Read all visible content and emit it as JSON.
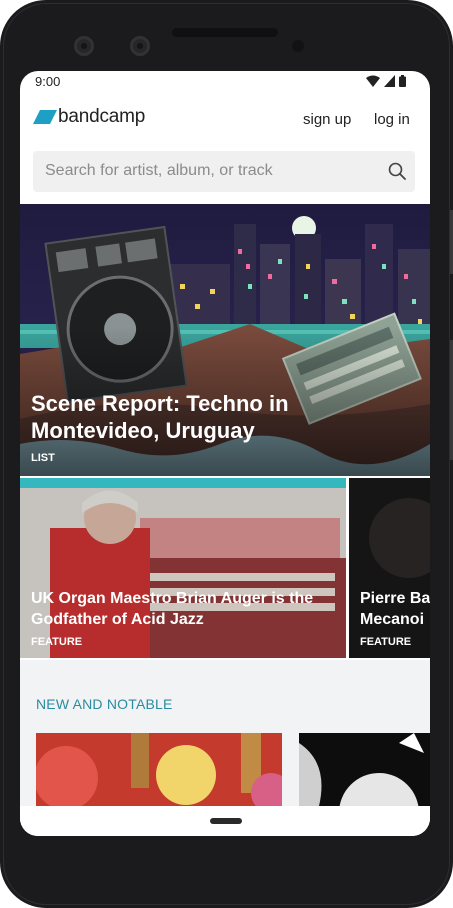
{
  "status_bar": {
    "time": "9:00",
    "icons": [
      "wifi-icon",
      "signal-icon",
      "battery-icon"
    ]
  },
  "header": {
    "logo_text": "bandcamp",
    "sign_up": "sign up",
    "log_in": "log in"
  },
  "search": {
    "placeholder": "Search for artist, album, or track",
    "icon": "search-icon"
  },
  "hero": {
    "title_line1": "Scene Report: Techno in",
    "title_line2": "Montevideo, Uruguay",
    "tag": "LIST"
  },
  "features": [
    {
      "title_line1": "UK Organ Maestro Brian Auger is the",
      "title_line2": "Godfather of Acid Jazz",
      "tag": "FEATURE"
    },
    {
      "title_line1": "Pierre Ba",
      "title_line2": "Mecanoi",
      "tag": "FEATURE"
    }
  ],
  "notable": {
    "heading": "NEW AND NOTABLE"
  },
  "colors": {
    "accent": "#2b8ba0",
    "logo": "#1da0c3",
    "hero_bg": "#1a1636"
  }
}
